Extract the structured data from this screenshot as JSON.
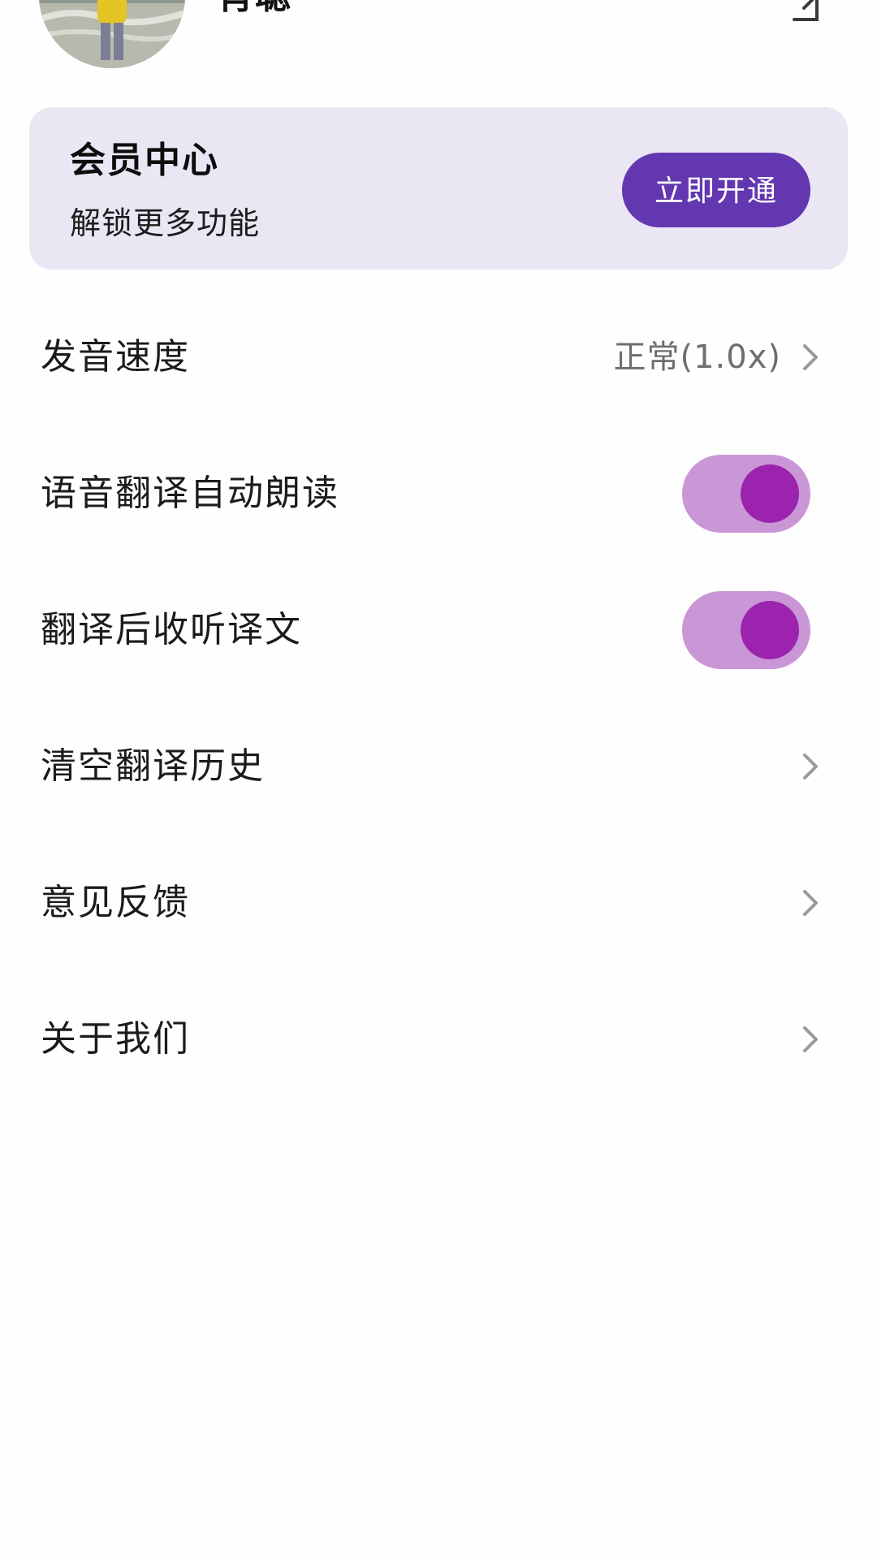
{
  "header": {
    "username": "肖聪",
    "avatar_icon": "avatar-photo",
    "edit_icon": "edit-icon"
  },
  "member_card": {
    "title": "会员中心",
    "subtitle": "解锁更多功能",
    "button_label": "立即开通",
    "button_color": "#6237b0",
    "card_color": "#ebe6f4"
  },
  "settings": {
    "items": [
      {
        "label": "发音速度",
        "value": "正常(1.0x)",
        "type": "chevron"
      },
      {
        "label": "语音翻译自动朗读",
        "type": "toggle",
        "on": true
      },
      {
        "label": "翻译后收听译文",
        "type": "toggle",
        "on": true
      },
      {
        "label": "清空翻译历史",
        "type": "chevron"
      },
      {
        "label": "意见反馈",
        "type": "chevron"
      },
      {
        "label": "关于我们",
        "type": "chevron"
      }
    ],
    "toggle_track_color": "#ca97d6",
    "toggle_knob_color": "#9b23ad"
  }
}
